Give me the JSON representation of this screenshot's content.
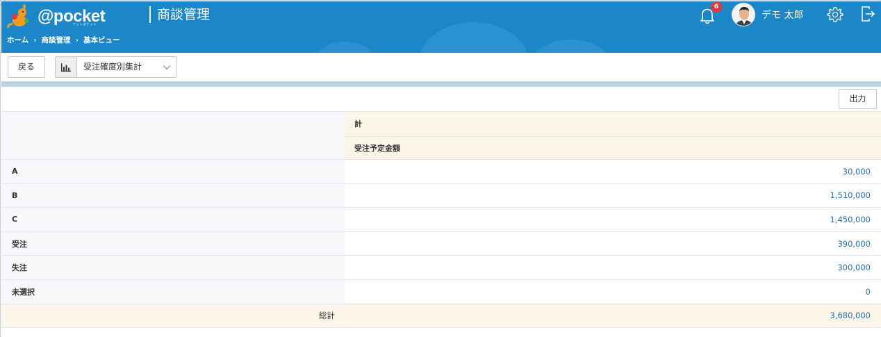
{
  "header": {
    "logo_text": "@pocket",
    "logo_subtext": "アットポケット",
    "app_title": "商談管理",
    "notification_count": "6",
    "user_name": "デモ 太郎",
    "colors": {
      "header_bg": "#1b87c9",
      "badge": "#e03a3a",
      "value_text": "#1f6fb6",
      "highlight_bg": "#fbf6e8"
    }
  },
  "breadcrumb": {
    "items": [
      {
        "label": "ホーム"
      },
      {
        "label": "商談管理"
      },
      {
        "label": "基本ビュー"
      }
    ],
    "separator": "›"
  },
  "toolbar": {
    "back_label": "戻る",
    "view_select_value": "受注確度別集計",
    "view_icon": "bar-chart-icon"
  },
  "report": {
    "export_label": "出力",
    "column_group": "計",
    "column_header": "受注予定金額",
    "rows": [
      {
        "label": "A",
        "value": "30,000"
      },
      {
        "label": "B",
        "value": "1,510,000"
      },
      {
        "label": "C",
        "value": "1,450,000"
      },
      {
        "label": "受注",
        "value": "390,000"
      },
      {
        "label": "失注",
        "value": "300,000"
      },
      {
        "label": "未選択",
        "value": "0"
      }
    ],
    "total_label": "総計",
    "total_value": "3,680,000"
  }
}
